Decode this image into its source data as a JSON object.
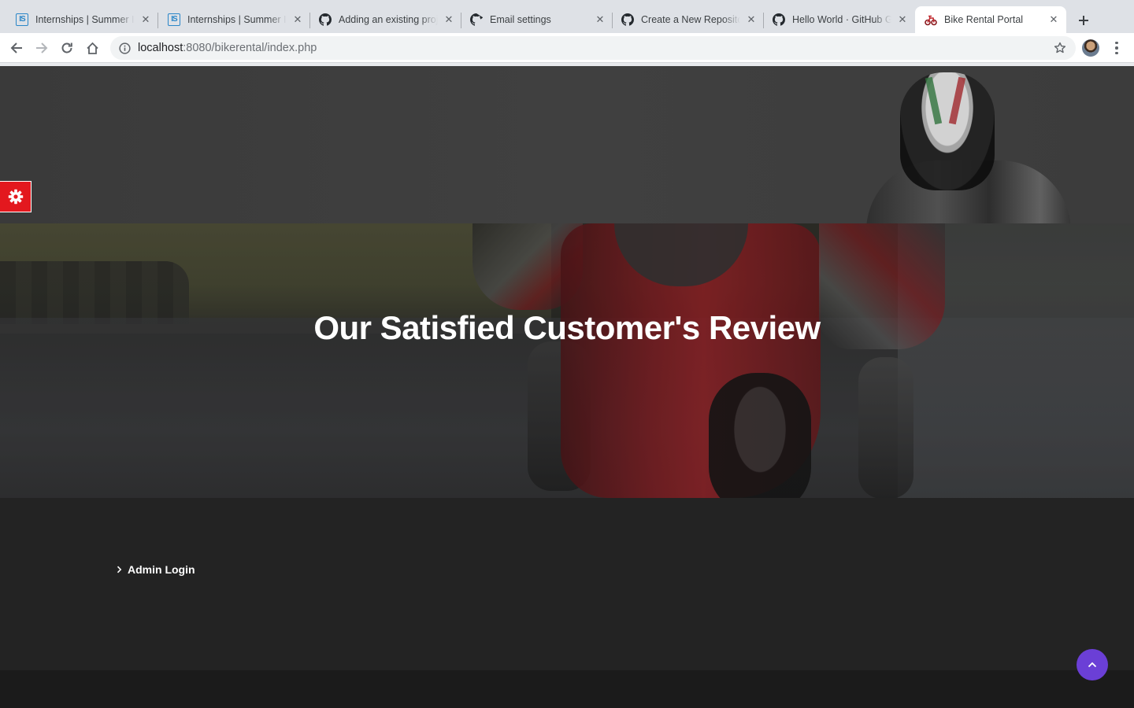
{
  "browser": {
    "tabs": [
      {
        "title": "Internships | Summer Internships",
        "favicon": "internshala-icon",
        "active": false
      },
      {
        "title": "Internships | Summer Internships",
        "favicon": "internshala-icon",
        "active": false
      },
      {
        "title": "Adding an existing project",
        "favicon": "github-icon",
        "active": false
      },
      {
        "title": "Email settings",
        "favicon": "github-icon",
        "active": false
      },
      {
        "title": "Create a New Repository",
        "favicon": "github-icon",
        "active": false
      },
      {
        "title": "Hello World · GitHub Guides",
        "favicon": "github-icon",
        "active": false
      },
      {
        "title": "Bike Rental Portal",
        "favicon": "bike-icon",
        "active": true
      }
    ],
    "address": {
      "host": "localhost",
      "path": ":8080/bikerental/index.php"
    }
  },
  "hero": {
    "title_bold": "Our Satisfied",
    "title_light": "Customer's Review"
  },
  "footer": {
    "admin_login_label": "Admin Login"
  },
  "colors": {
    "settings_button": "#e3181e",
    "back_to_top": "#6b3fd6",
    "footer_background": "#232323",
    "footer_bottom": "#1b1b1b"
  },
  "icons": {
    "settings": "gear-icon",
    "back_to_top": "chevron-up-icon",
    "admin_link": "chevron-right-icon"
  }
}
